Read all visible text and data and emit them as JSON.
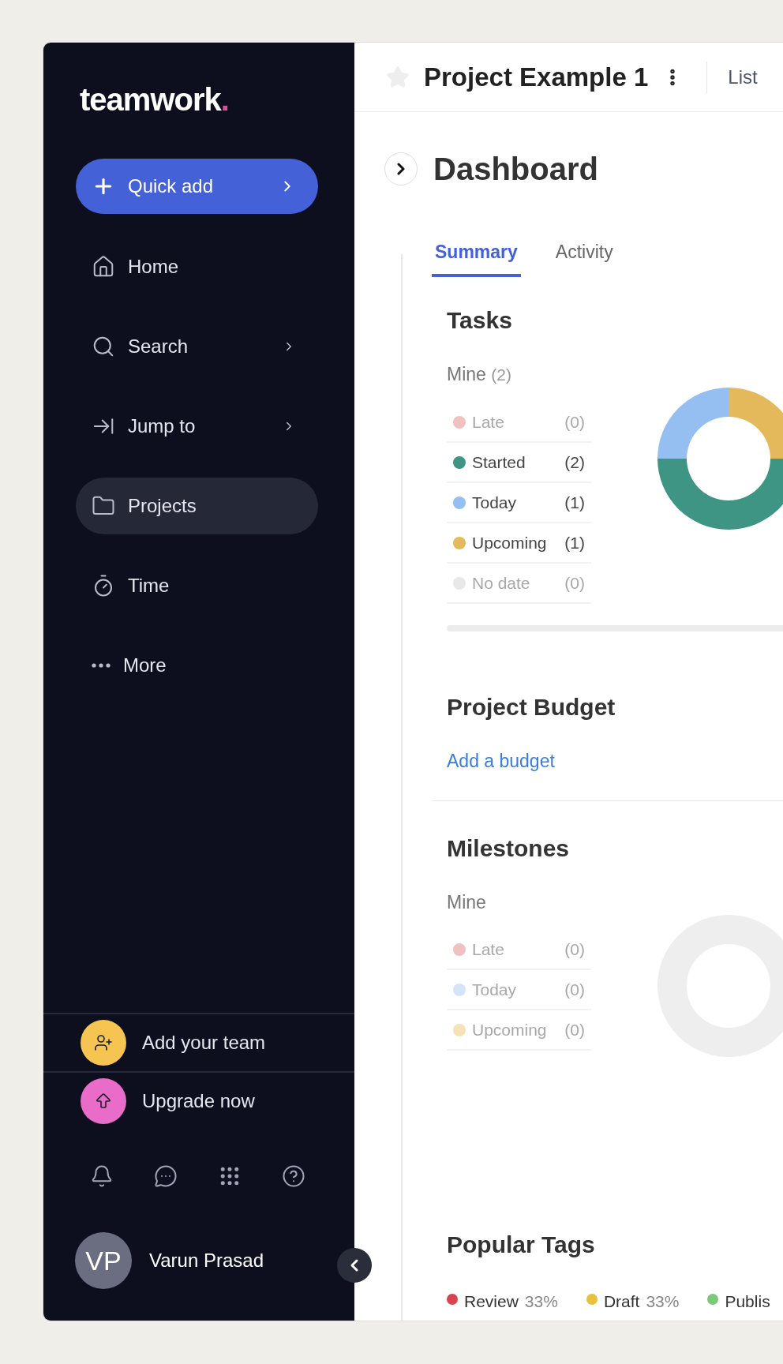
{
  "sidebar": {
    "logo": {
      "word": "teamwork",
      "mark": "."
    },
    "quick_add": {
      "label": "Quick add"
    },
    "nav": [
      {
        "label": "Home",
        "submenu": false,
        "selected": false
      },
      {
        "label": "Search",
        "submenu": true,
        "selected": false
      },
      {
        "label": "Jump to",
        "submenu": true,
        "selected": false
      },
      {
        "label": "Projects",
        "submenu": false,
        "selected": true
      },
      {
        "label": "Time",
        "submenu": false,
        "selected": false
      },
      {
        "label": "More",
        "submenu": false,
        "selected": false
      }
    ],
    "prompts": [
      {
        "label": "Add your team",
        "color": "#f5c451"
      },
      {
        "label": "Upgrade now",
        "color": "#e96cc8"
      }
    ],
    "user": {
      "initials": "VP",
      "name": "Varun Prasad"
    }
  },
  "header": {
    "starred": false,
    "title": "Project Example 1",
    "view": "List"
  },
  "page": {
    "title": "Dashboard",
    "tabs": [
      {
        "label": "Summary",
        "selected": true
      },
      {
        "label": "Activity",
        "selected": false
      }
    ]
  },
  "tasks": {
    "title": "Tasks",
    "filter": "Mine",
    "filter_count": "(2)",
    "statuses": [
      {
        "count": "(0)",
        "color": "#efc1c0",
        "muted": true
      },
      {
        "count": "(2)",
        "color": "#3f9584",
        "muted": false
      },
      {
        "count": "(1)",
        "color": "#94bff0",
        "muted": false
      },
      {
        "count": "(1)",
        "color": "#e4b95b",
        "muted": false
      },
      {
        "count": "(0)",
        "color": "#e8e8e8",
        "muted": true
      }
    ],
    "chart_data": {
      "type": "donut",
      "categories": [
        "Late",
        "Started",
        "Today",
        "Upcoming",
        "No date"
      ],
      "values": [
        0,
        50,
        25,
        25,
        0
      ]
    }
  },
  "budget": {
    "title": "Project Budget",
    "link": "Add a budget"
  },
  "milestones": {
    "title": "Milestones",
    "filter": "Mine",
    "statuses": [
      {
        "label": "Late",
        "count": "(0)",
        "color": "#efc1c0",
        "muted": true
      },
      {
        "label": "Today",
        "count": "(0)",
        "color": "#d5e4f7",
        "muted": true
      },
      {
        "label": "Upcoming",
        "count": "(0)",
        "color": "#f5e2b6",
        "muted": true
      }
    ]
  },
  "tags": {
    "title": "Popular Tags",
    "items": [
      {
        "label": "Review",
        "share": "33%",
        "color": "#d9454f"
      },
      {
        "label": "Draft",
        "share": "33%",
        "color": "#e9c03c"
      },
      {
        "label": "Publis",
        "color": "#7cc97a"
      }
    ]
  }
}
